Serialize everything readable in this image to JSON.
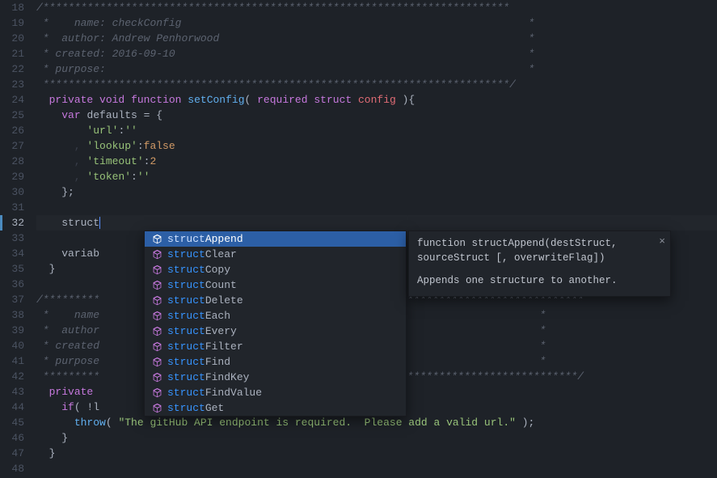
{
  "gutter": {
    "start": 18,
    "end": 48
  },
  "lines": {
    "l18": {
      "dim": "",
      "comment": "/**************************************************************************"
    },
    "l19": {
      "dim": " *    ",
      "key": "name",
      "sep": ": ",
      "val": "checkConfig",
      "pad": "                                                       ",
      "end": "*"
    },
    "l20": {
      "dim": " *  ",
      "key": "author",
      "sep": ": ",
      "val": "Andrew Penhorwood",
      "pad": "                                                 ",
      "end": "*"
    },
    "l21": {
      "dim": " * ",
      "key": "created",
      "sep": ": ",
      "val": "2016-09-10",
      "pad": "                                                        ",
      "end": "*"
    },
    "l22": {
      "dim": " * ",
      "key": "purpose",
      "sep": ":",
      "val": "",
      "pad": "                                                                   ",
      "end": "*"
    },
    "l23": {
      "dim": " ",
      "comment": "**************************************************************************/"
    },
    "l24": {
      "indent": "  ",
      "kw1": "private",
      "sp1": " ",
      "kw2": "void",
      "sp2": " ",
      "kw3": "function",
      "sp3": " ",
      "fn": "setConfig",
      "p1": "( ",
      "kw4": "required",
      "sp4": " ",
      "kw5": "struct",
      "sp5": " ",
      "param": "config",
      "p2": " ){"
    },
    "l25": {
      "indent": "    ",
      "kw": "var",
      "sp": " ",
      "name": "defaults",
      "eq": " = {"
    },
    "l26": {
      "indent": "        ",
      "key": "'url'",
      "sep": ":",
      "val": "''"
    },
    "l27": {
      "indent": "      , ",
      "key": "'lookup'",
      "sep": ":",
      "val": "false",
      "bool": true
    },
    "l28": {
      "indent": "      , ",
      "key": "'timeout'",
      "sep": ":",
      "val": "2",
      "num": true
    },
    "l29": {
      "indent": "      , ",
      "key": "'token'",
      "sep": ":",
      "val": "''"
    },
    "l30": {
      "indent": "    ",
      "txt": "};"
    },
    "l31": {
      "txt": ""
    },
    "l32": {
      "indent": "    ",
      "txt": "struct"
    },
    "l33": {
      "txt": ""
    },
    "l34": {
      "indent": "    ",
      "txt": "variab"
    },
    "l35": {
      "indent": "  ",
      "txt": "}"
    },
    "l36": {
      "txt": ""
    },
    "l37": {
      "dim": "",
      "comment_l": "/*********",
      "comment_r": "***********************************"
    },
    "l38": {
      "dim": " *    ",
      "key": "name",
      "pad": "                            ",
      "end": "*"
    },
    "l39": {
      "dim": " *  ",
      "key": "author",
      "pad": "                            ",
      "end": "*"
    },
    "l40": {
      "dim": " * ",
      "key": "created",
      "pad": "                            ",
      "end": "*"
    },
    "l41": {
      "dim": " * ",
      "key": "purpose",
      "pad": "                            ",
      "end": "*"
    },
    "l42": {
      "dim": " *********",
      "comment_r": "**********************************/"
    },
    "l43": {
      "indent": "  ",
      "kw": "private",
      "rest": " "
    },
    "l44": {
      "indent": "    ",
      "kw": "if",
      "rest": "( !l"
    },
    "l45": {
      "indent": "      ",
      "fn": "throw",
      "p1": "( ",
      "str": "\"The gitHub API endpoint is required.  Please add a valid url.\"",
      "p2": " );"
    },
    "l46": {
      "indent": "    ",
      "txt": "}"
    },
    "l47": {
      "indent": "  ",
      "txt": "}"
    },
    "l48": {
      "txt": ""
    }
  },
  "autocomplete": {
    "match": "struct",
    "items": [
      {
        "rest": "Append",
        "selected": true
      },
      {
        "rest": "Clear"
      },
      {
        "rest": "Copy"
      },
      {
        "rest": "Count"
      },
      {
        "rest": "Delete"
      },
      {
        "rest": "Each"
      },
      {
        "rest": "Every"
      },
      {
        "rest": "Filter"
      },
      {
        "rest": "Find"
      },
      {
        "rest": "FindKey"
      },
      {
        "rest": "FindValue"
      },
      {
        "rest": "Get"
      }
    ]
  },
  "doc": {
    "signature": "function structAppend(destStruct, sourceStruct [, overwriteFlag])",
    "description": "Appends one structure to another.",
    "close": "×"
  }
}
